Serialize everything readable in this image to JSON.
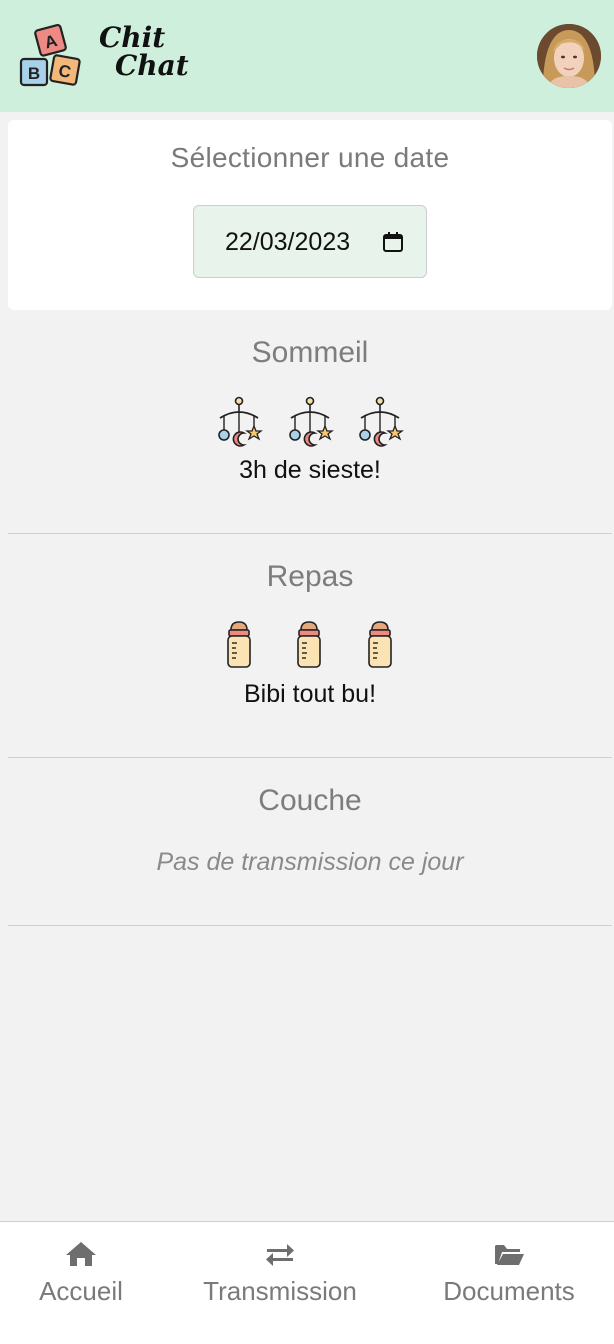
{
  "header": {
    "logo_line1": "Chit",
    "logo_line2": "Chat",
    "logo_blocks": [
      "A",
      "B",
      "C"
    ],
    "avatar_icon": "user-avatar-photo"
  },
  "date_picker": {
    "title": "Sélectionner une date",
    "value": "22/03/2023",
    "icon": "calendar-icon"
  },
  "sections": [
    {
      "title": "Sommeil",
      "icon": "baby-mobile-icon",
      "icon_count": 3,
      "text": "3h de sieste!"
    },
    {
      "title": "Repas",
      "icon": "baby-bottle-icon",
      "icon_count": 3,
      "text": "Bibi tout bu!"
    },
    {
      "title": "Couche",
      "note": "Pas de transmission ce jour"
    }
  ],
  "bottom_nav": [
    {
      "label": "Accueil",
      "icon": "home-icon"
    },
    {
      "label": "Transmission",
      "icon": "swap-arrows-icon"
    },
    {
      "label": "Documents",
      "icon": "folder-open-icon"
    }
  ],
  "colors": {
    "header_bg": "#cdefdc",
    "page_bg": "#f3f2f2",
    "date_input_bg": "#e8f3ec",
    "muted_text": "#7d7d7d"
  }
}
